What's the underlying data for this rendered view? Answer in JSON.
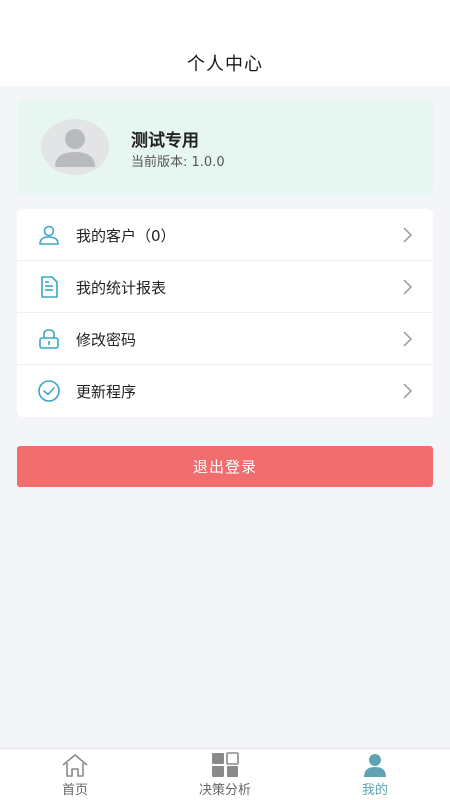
{
  "header": {
    "title": "个人中心"
  },
  "profile": {
    "name": "测试专用",
    "version": "当前版本: 1.0.0"
  },
  "menu": {
    "items": [
      {
        "label": "我的客户（0）",
        "icon": "user-icon"
      },
      {
        "label": "我的统计报表",
        "icon": "document-icon"
      },
      {
        "label": "修改密码",
        "icon": "lock-icon"
      },
      {
        "label": "更新程序",
        "icon": "check-circle-icon"
      }
    ]
  },
  "logout": {
    "label": "退出登录"
  },
  "nav": {
    "items": [
      {
        "label": "首页",
        "icon": "home-icon"
      },
      {
        "label": "决策分析",
        "icon": "grid-icon"
      },
      {
        "label": "我的",
        "icon": "person-icon",
        "active": true
      }
    ]
  },
  "colors": {
    "accent": "#3aa6c9",
    "logout": "#f26d6e",
    "profile_bg": "#e8f6f1",
    "nav_active": "#5fa3b4"
  }
}
